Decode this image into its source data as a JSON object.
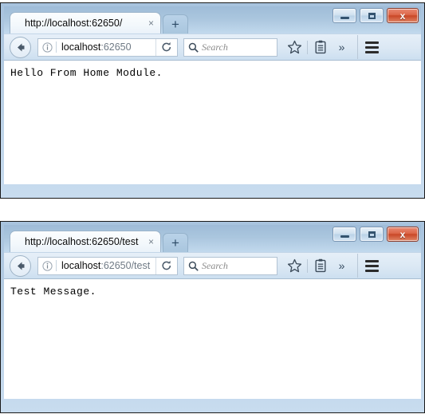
{
  "colors": {
    "window_frame": "#b0cae1",
    "titlebar_gradient_top": "#9fbcd8",
    "titlebar_gradient_bottom": "#c2d9ed",
    "toolbar_bg": "#dbe8f4",
    "close_button_red": "#dc6647",
    "url_host_text": "#0a0a0a",
    "url_path_text": "#6f7a85",
    "content_bg": "#ffffff",
    "page_text": "#000000"
  },
  "windows": [
    {
      "window_controls": {
        "minimize_label": "Minimize",
        "maximize_label": "Maximize",
        "close_label": "x"
      },
      "tab": {
        "title": "http://localhost:62650/",
        "close_label": "×"
      },
      "new_tab": {
        "label": "+"
      },
      "navbar": {
        "back_label": "Back",
        "identity_label": "i",
        "url_host": "localhost",
        "url_rest": ":62650",
        "url_full": "localhost:62650",
        "reload_label": "Reload",
        "search_placeholder": "Search",
        "bookmark_label": "Bookmark this page",
        "library_label": "Library",
        "overflow_label": "»",
        "menu_label": "Open menu"
      },
      "content": {
        "text": "Hello From Home Module."
      }
    },
    {
      "window_controls": {
        "minimize_label": "Minimize",
        "maximize_label": "Maximize",
        "close_label": "x"
      },
      "tab": {
        "title": "http://localhost:62650/test",
        "close_label": "×"
      },
      "new_tab": {
        "label": "+"
      },
      "navbar": {
        "back_label": "Back",
        "identity_label": "i",
        "url_host": "localhost",
        "url_rest": ":62650/test",
        "url_full": "localhost:62650/test",
        "reload_label": "Reload",
        "search_placeholder": "Search",
        "bookmark_label": "Bookmark this page",
        "library_label": "Library",
        "overflow_label": "»",
        "menu_label": "Open menu"
      },
      "content": {
        "text": "Test Message."
      }
    }
  ]
}
